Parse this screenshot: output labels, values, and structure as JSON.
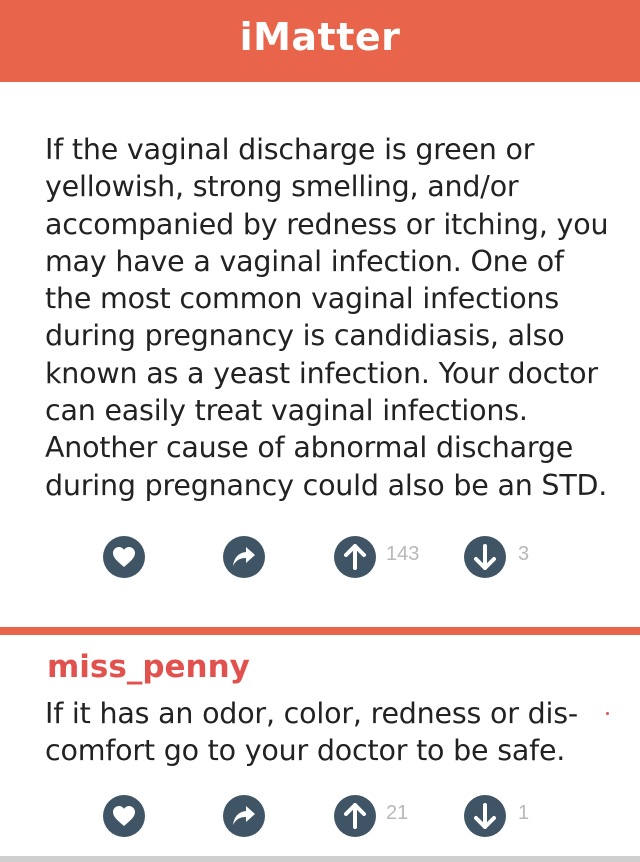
{
  "app": {
    "title": "iMatter"
  },
  "post": {
    "text": "If the vaginal discharge is green or yellowish, strong smelling, and/or accompanied by redness or itching, you may have a vaginal infection. One of the most common vaginal infections during pregnancy is candidiasis, also known as a yeast infection. Your doctor can easily treat vaginal infections. Another cause of abnormal discharge during pregnancy could also be an STD.",
    "upvotes": "143",
    "downvotes": "3"
  },
  "reply": {
    "username": "miss_penny",
    "text": "If it has an odor, color, redness or dis-comfort go to your doctor to be safe.",
    "upvotes": "21",
    "downvotes": "1"
  },
  "colors": {
    "header": "#e8644a",
    "username": "#e1524e",
    "icon_bg": "#3f5566",
    "count": "#b8b8b8"
  },
  "icons": [
    "heart-icon",
    "share-icon",
    "arrow-up-icon",
    "arrow-down-icon"
  ]
}
